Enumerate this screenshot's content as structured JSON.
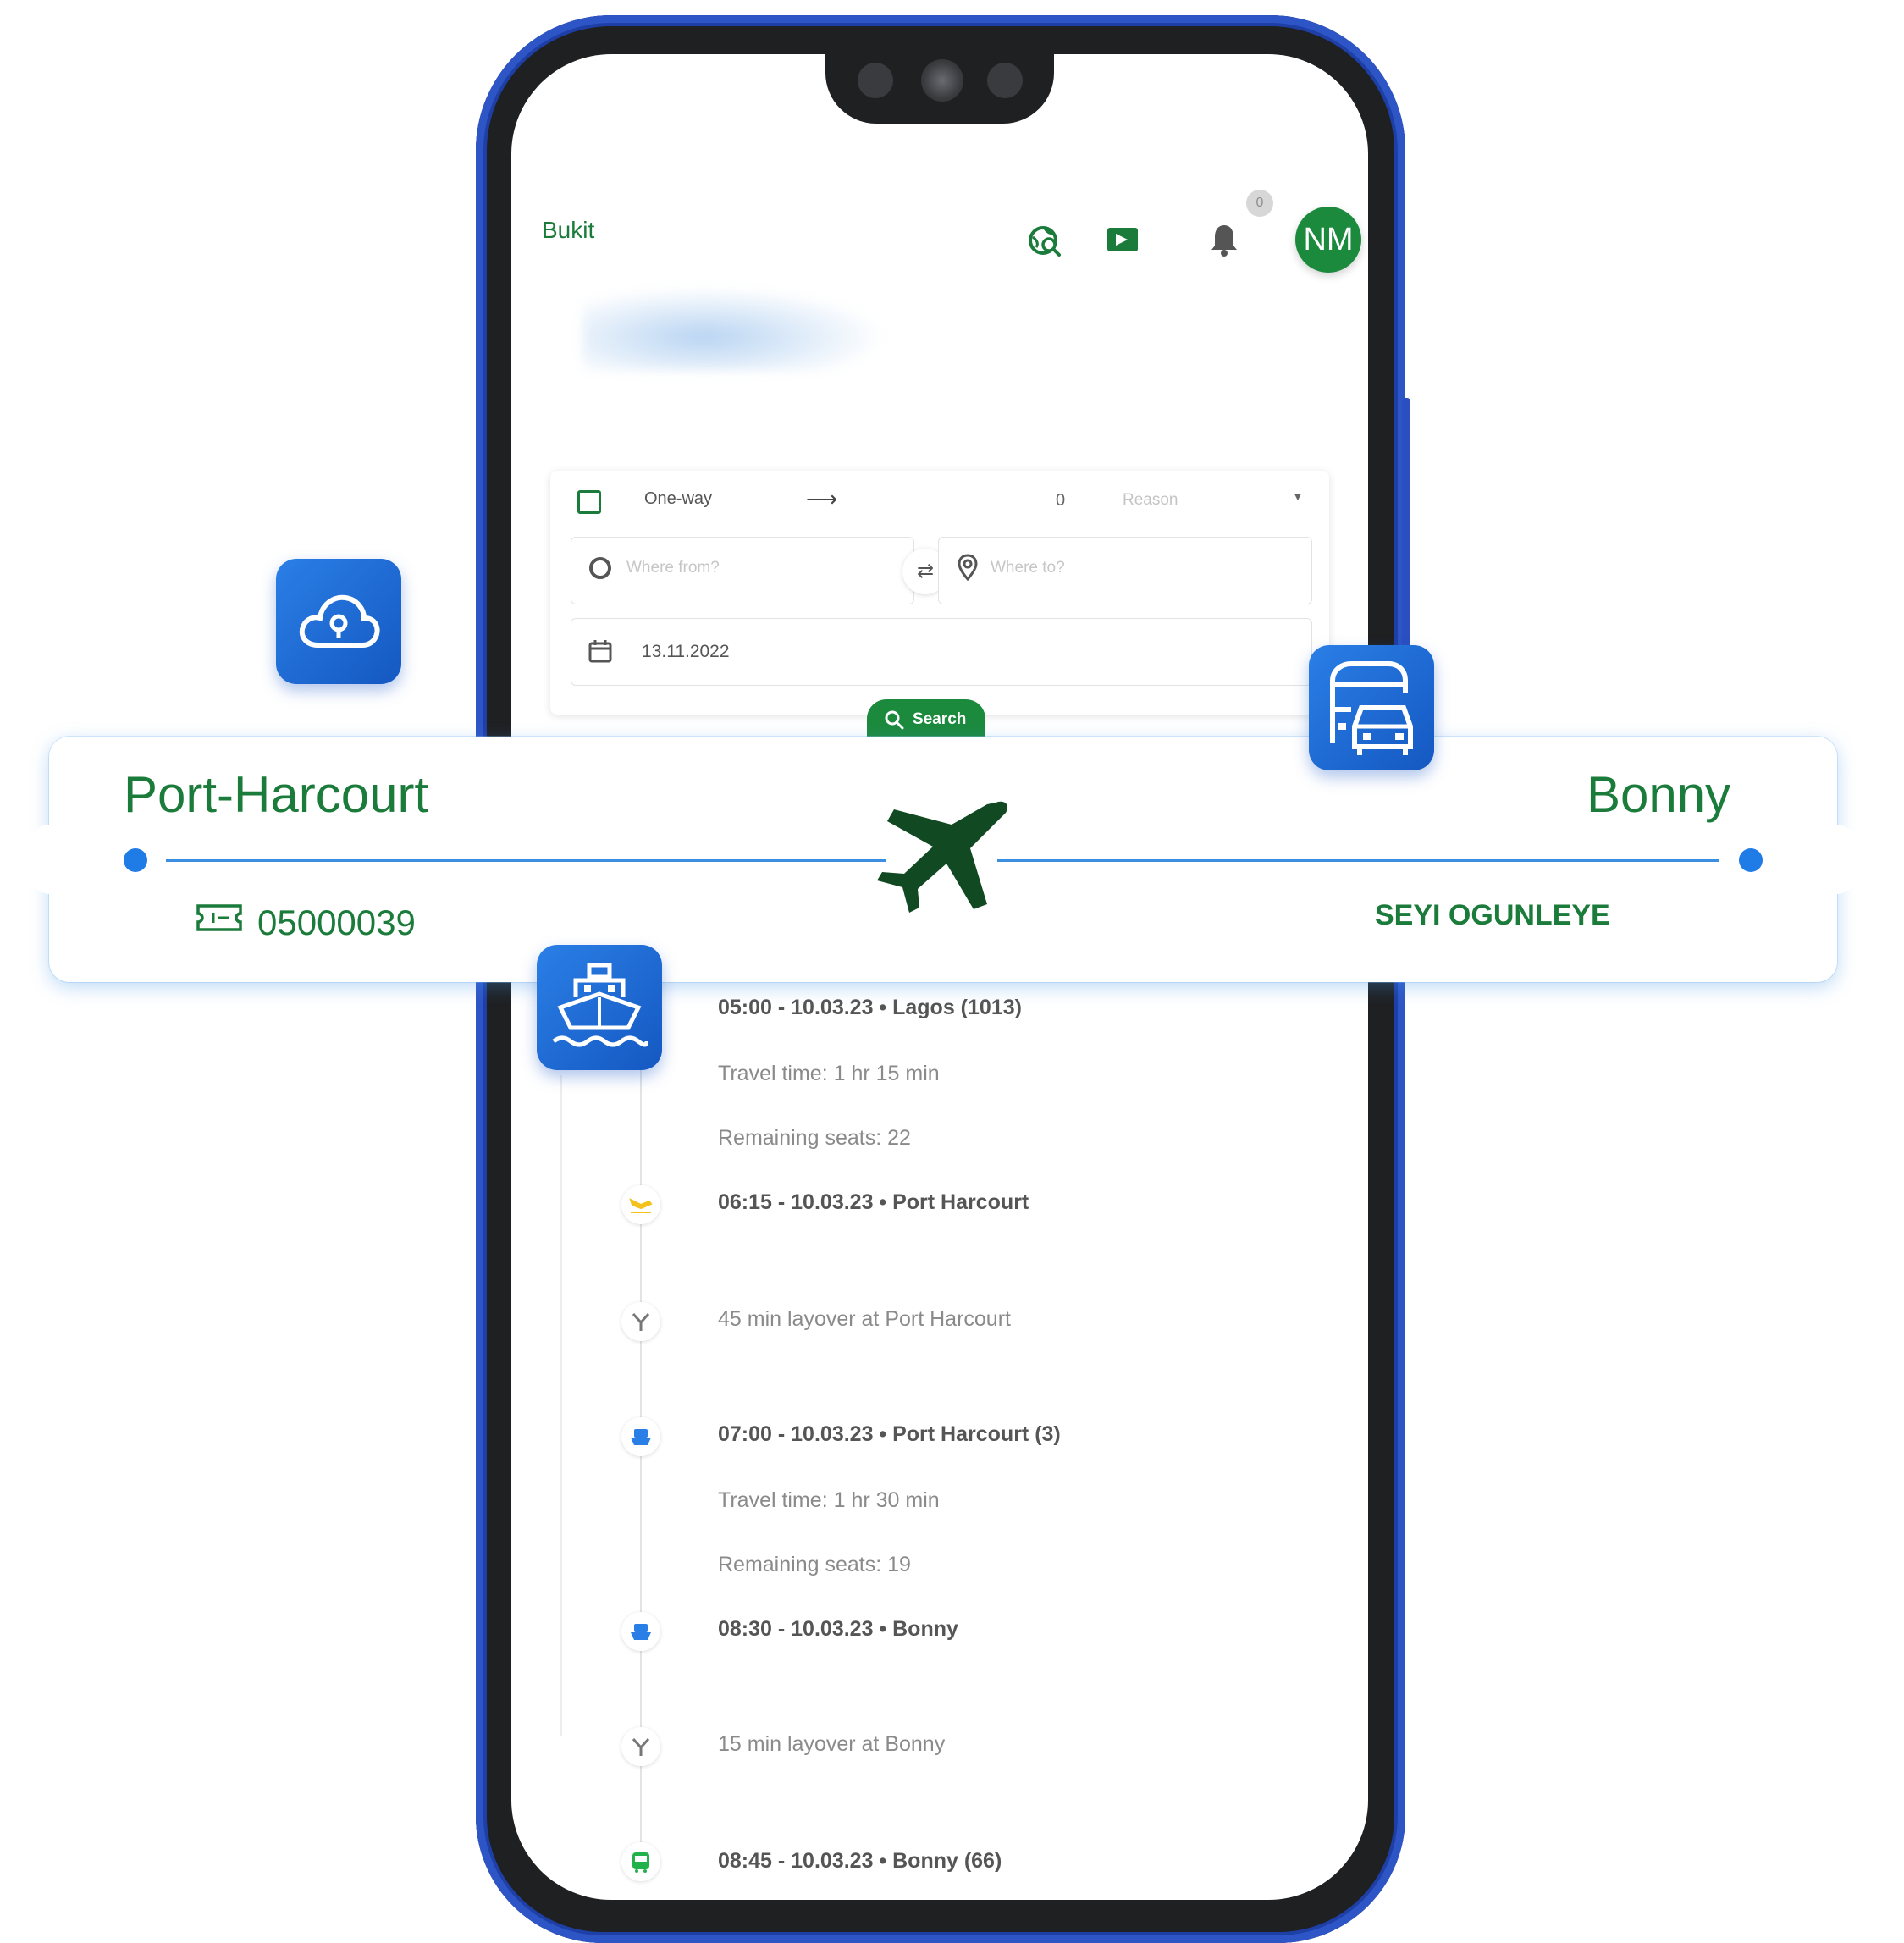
{
  "app": {
    "title": "Bukit",
    "notification_count": "0",
    "avatar_initials": "NM"
  },
  "search": {
    "trip_type": "One-way",
    "passenger_count": "0",
    "reason_placeholder": "Reason",
    "from_placeholder": "Where from?",
    "to_placeholder": "Where to?",
    "date": "13.11.2022",
    "search_label": "Search"
  },
  "ticket": {
    "from": "Port-Harcourt",
    "to": "Bonny",
    "ticket_number": "05000039",
    "passenger": "SEYI OGUNLEYE"
  },
  "itinerary": [
    {
      "icon": "plane-takeoff-icon",
      "main": "05:00 - 10.03.23 • Lagos (1013)",
      "sub": [
        "Travel time: 1 hr 15 min",
        "Remaining seats: 22"
      ]
    },
    {
      "icon": "plane-landing-icon",
      "main": "06:15 - 10.03.23 • Port Harcourt",
      "sub": []
    },
    {
      "icon": "layover-icon",
      "main": "",
      "sub": [
        "45 min layover at Port Harcourt"
      ]
    },
    {
      "icon": "boat-icon",
      "main": "07:00 - 10.03.23 • Port Harcourt (3)",
      "sub": [
        "Travel time: 1 hr 30 min",
        "Remaining seats: 19"
      ]
    },
    {
      "icon": "boat-icon",
      "main": "08:30 - 10.03.23 • Bonny",
      "sub": []
    },
    {
      "icon": "layover-icon",
      "main": "",
      "sub": [
        "15 min layover at Bonny"
      ]
    },
    {
      "icon": "bus-icon",
      "main": "08:45 - 10.03.23 • Bonny (66)",
      "sub": []
    }
  ],
  "colors": {
    "brand_green": "#1b7b3a",
    "accent_blue": "#1f7ce6",
    "phone_frame": "#2e55c6"
  }
}
